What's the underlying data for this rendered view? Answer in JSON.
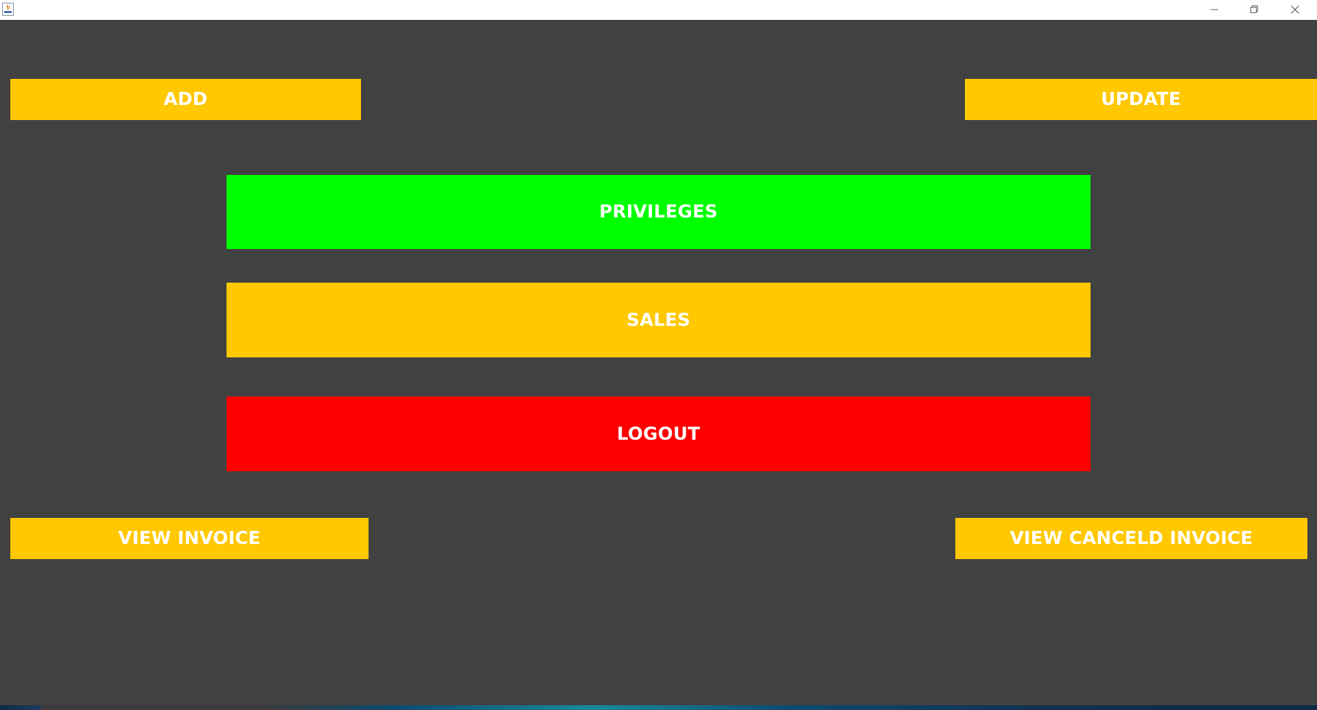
{
  "window": {
    "title": "",
    "controls": [
      "minimize-icon",
      "restore-icon",
      "close-icon"
    ]
  },
  "buttons": {
    "add": "ADD",
    "update": "UPDATE",
    "privileges": "PRIVILEGES",
    "sales": "SALES",
    "logout": "LOGOUT",
    "view_invoice": "VIEW INVOICE",
    "view_canceled_invoice": "VIEW CANCELD INVOICE"
  },
  "colors": {
    "background": "#414141",
    "yellow": "#ffc800",
    "green": "#00ff00",
    "red": "#ff0000",
    "text": "#ffffff"
  }
}
